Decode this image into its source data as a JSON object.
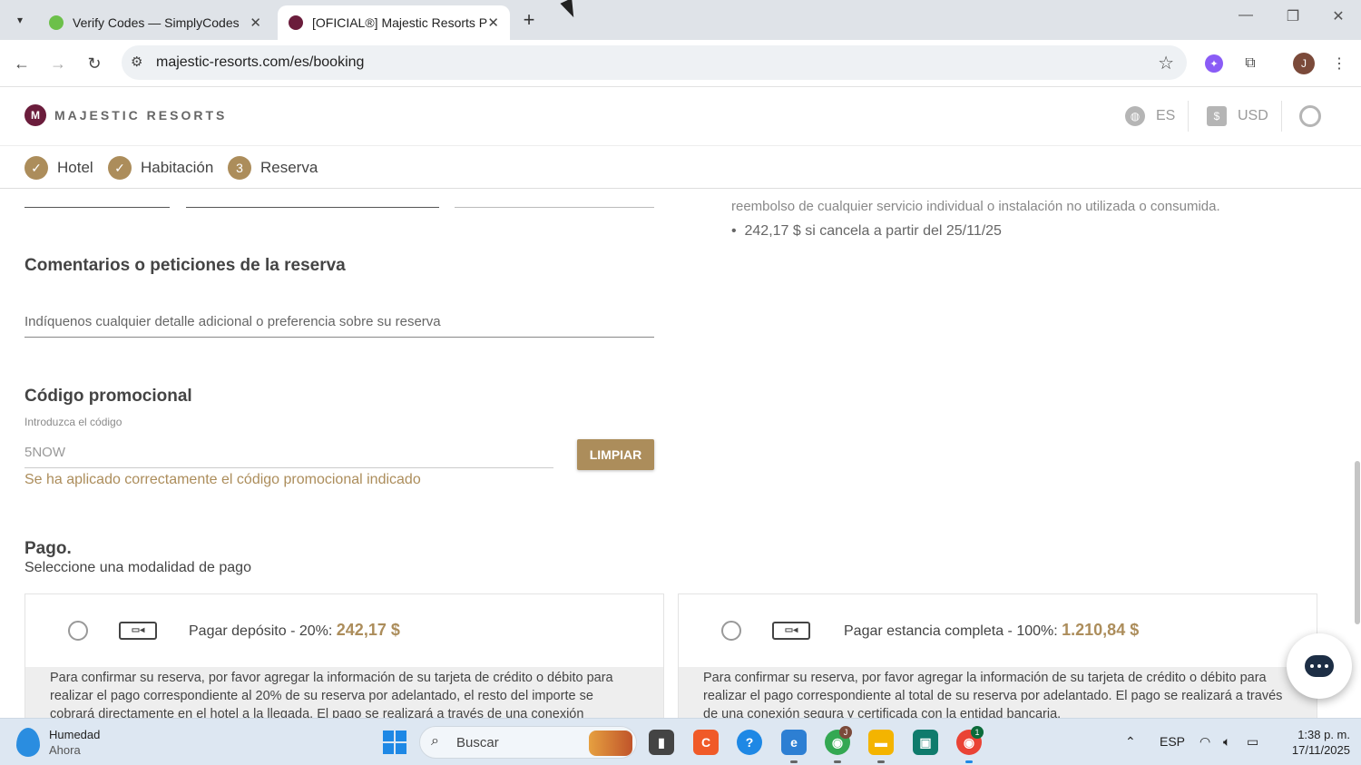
{
  "browser": {
    "tabs": [
      {
        "title": "Verify Codes — SimplyCodes",
        "active": false
      },
      {
        "title": "[OFICIAL®] Majestic Resorts Pu",
        "active": true
      }
    ],
    "url": "majestic-resorts.com/es/booking",
    "profile_initial": "J"
  },
  "site": {
    "brand": "MAJESTIC RESORTS",
    "brand_mark": "M",
    "language": "ES",
    "currency": "USD"
  },
  "steps": [
    {
      "label": "Hotel",
      "done": true
    },
    {
      "label": "Habitación",
      "done": true
    },
    {
      "label": "Reserva",
      "number": "3"
    }
  ],
  "policy": {
    "text_partial": "reembolso de cualquier servicio individual o instalación no utilizada o consumida.",
    "bullet": "242,17 $ si cancela a partir del 25/11/25"
  },
  "comments": {
    "heading": "Comentarios o peticiones de la reserva",
    "placeholder": "Indíquenos cualquier detalle adicional o preferencia sobre su reserva"
  },
  "promo": {
    "heading": "Código promocional",
    "label": "Introduzca el código",
    "value": "5NOW",
    "clear_button": "LIMPIAR",
    "success": "Se ha aplicado correctamente el código promocional indicado"
  },
  "payment": {
    "heading": "Pago.",
    "subheading": "Seleccione una modalidad de pago",
    "options": [
      {
        "title": "Pagar depósito - 20%:",
        "amount": "242,17 $",
        "description": "Para confirmar su reserva, por favor agregar la información de su tarjeta de crédito o débito para realizar el pago correspondiente al 20% de su reserva por adelantado, el resto del importe se cobrará directamente en el hotel a la llegada. El pago se realizará a través de una conexión"
      },
      {
        "title": "Pagar estancia completa - 100%:",
        "amount": "1.210,84 $",
        "description": "Para confirmar su reserva, por favor agregar la información de su tarjeta de crédito o débito para realizar el pago correspondiente al total de su reserva por adelantado. El pago se realizará a través de una conexión segura y certificada con la entidad bancaria."
      }
    ]
  },
  "taskbar": {
    "weather_title": "Humedad",
    "weather_sub": "Ahora",
    "search_label": "Buscar",
    "lang": "ESP",
    "time": "1:38 p. m.",
    "date": "17/11/2025",
    "chrome_badge": "J",
    "chrome2_badge": "1"
  },
  "colors": {
    "accent": "#ac8d5b",
    "brand": "#6b1d3c"
  }
}
